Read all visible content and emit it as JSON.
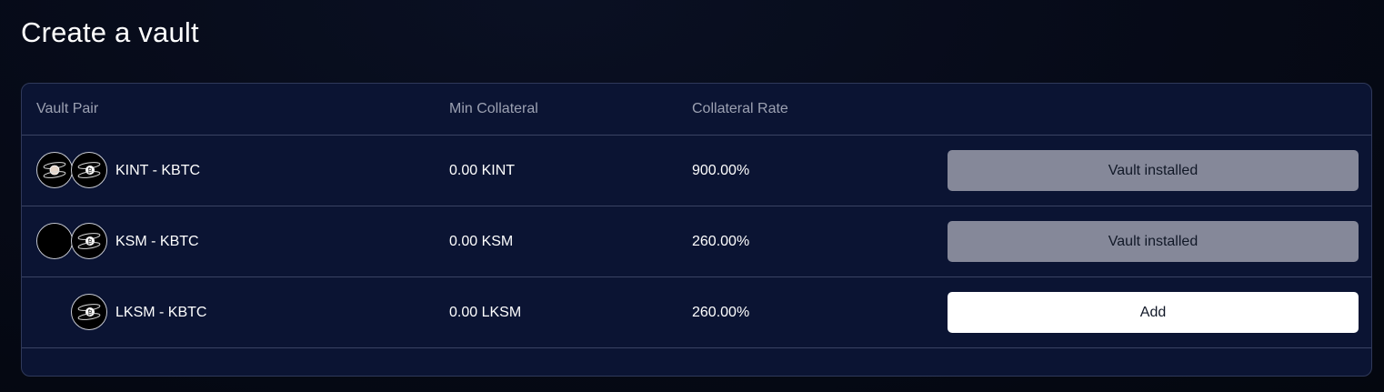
{
  "page": {
    "title": "Create a vault"
  },
  "table": {
    "headers": {
      "vault_pair": "Vault Pair",
      "min_collateral": "Min Collateral",
      "collateral_rate": "Collateral Rate"
    },
    "rows": [
      {
        "pair": "KINT - KBTC",
        "min_collateral": "0.00 KINT",
        "collateral_rate": "900.00%",
        "action": "Vault installed",
        "action_state": "disabled",
        "icons": [
          "kint-token-icon",
          "kbtc-token-icon"
        ]
      },
      {
        "pair": "KSM - KBTC",
        "min_collateral": "0.00 KSM",
        "collateral_rate": "260.00%",
        "action": "Vault installed",
        "action_state": "disabled",
        "icons": [
          "ksm-token-icon",
          "kbtc-token-icon"
        ]
      },
      {
        "pair": "LKSM - KBTC",
        "min_collateral": "0.00 LKSM",
        "collateral_rate": "260.00%",
        "action": "Add",
        "action_state": "enabled",
        "icons": [
          "kbtc-token-icon"
        ]
      }
    ]
  },
  "colors": {
    "background": "#060a17",
    "card": "#0b1433",
    "border": "#3a4363",
    "header_text": "#9ca1b2",
    "button_disabled": "#858899",
    "button_enabled": "#ffffff"
  }
}
